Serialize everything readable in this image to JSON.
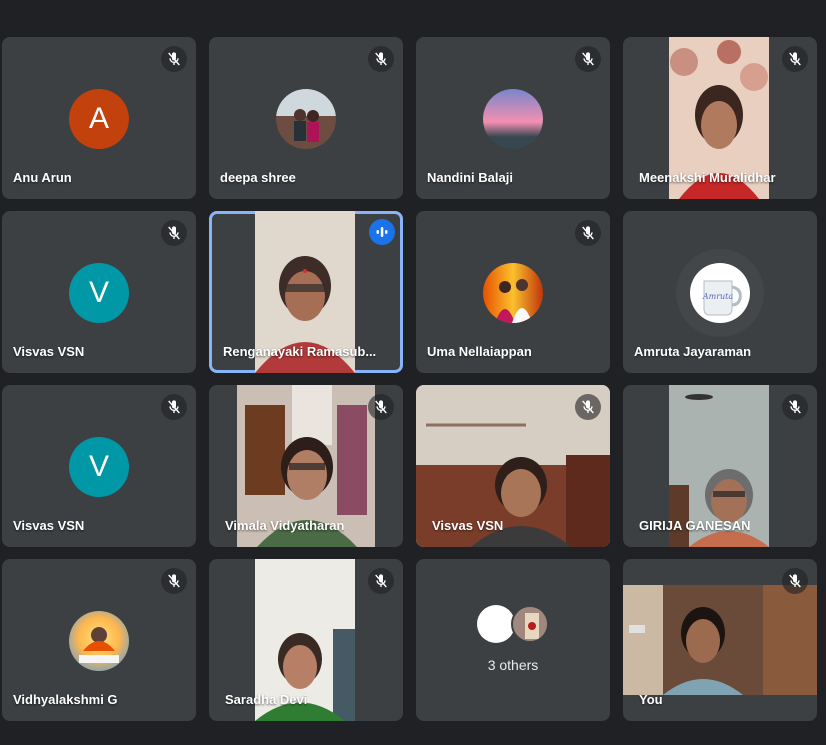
{
  "participants": [
    {
      "name": "Anu Arun",
      "avatar_letter": "A",
      "avatar_color": "#c2410c",
      "muted": true
    },
    {
      "name": "deepa shree",
      "muted": true
    },
    {
      "name": "Nandini Balaji",
      "muted": true
    },
    {
      "name": "Meenakshi Muralidhar",
      "muted": true
    },
    {
      "name": "Visvas VSN",
      "avatar_letter": "V",
      "avatar_color": "#0097a7",
      "muted": true
    },
    {
      "name": "Renganayaki Ramasub...",
      "speaking": true
    },
    {
      "name": "Uma Nellaiappan",
      "muted": true
    },
    {
      "name": "Amruta Jayaraman"
    },
    {
      "name": "Visvas VSN",
      "avatar_letter": "V",
      "avatar_color": "#0097a7",
      "muted": true
    },
    {
      "name": "Vimala Vidyatharan",
      "muted": true
    },
    {
      "name": "Visvas VSN",
      "muted": true
    },
    {
      "name": "GIRIJA GANESAN",
      "muted": true
    },
    {
      "name": "Vidhyalakshmi G",
      "muted": true
    },
    {
      "name": "Saradha Devi",
      "muted": true
    },
    {
      "others_label": "3 others"
    },
    {
      "name": "You",
      "muted": true
    }
  ],
  "mug_text": "Amruta"
}
